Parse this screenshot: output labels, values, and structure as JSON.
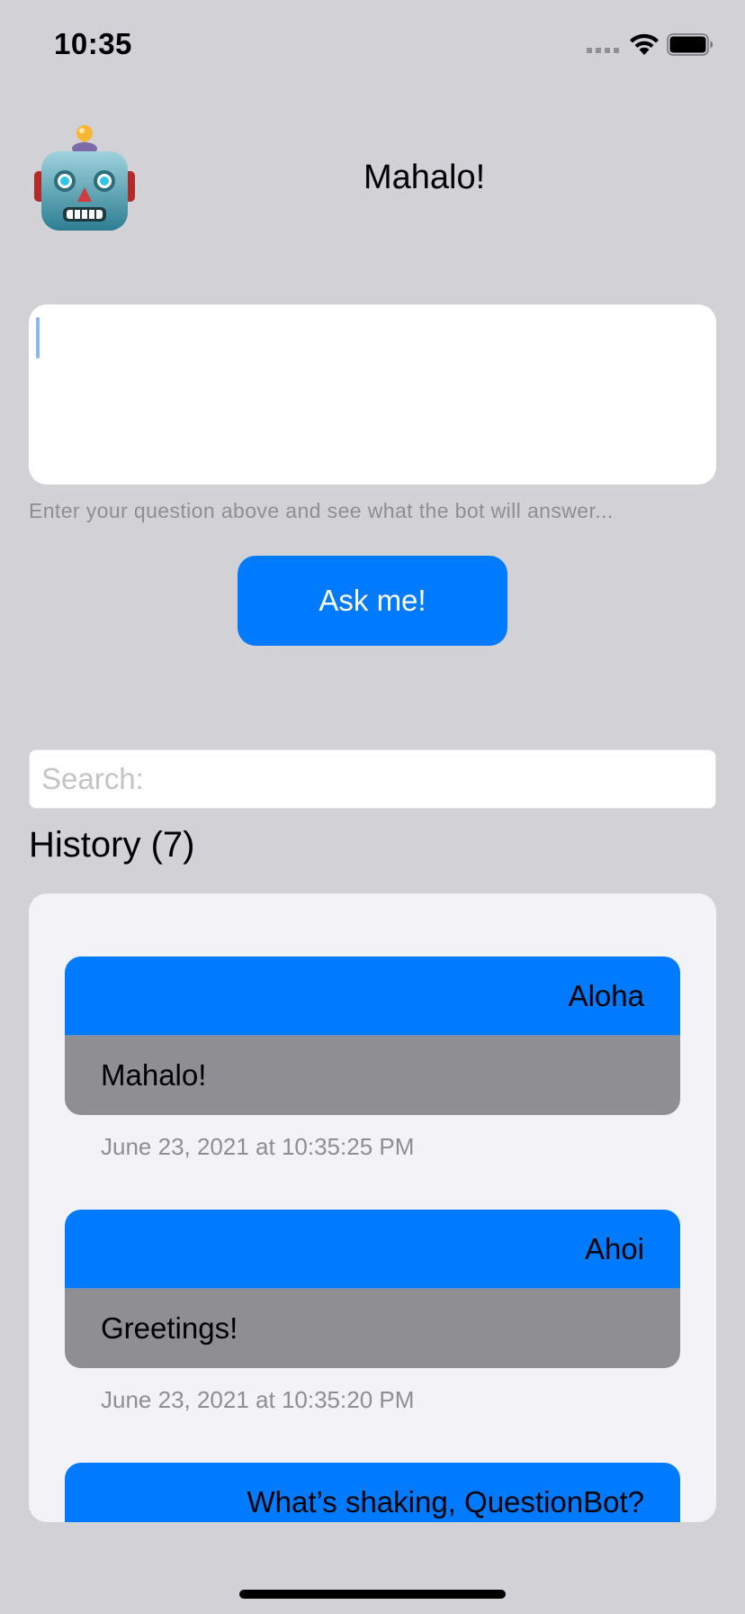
{
  "status_bar": {
    "time": "10:35"
  },
  "header": {
    "title": "Mahalo!",
    "avatar_icon": "robot-face-icon"
  },
  "question": {
    "value": "",
    "hint": "Enter your question above and see what the bot will answer..."
  },
  "ask_button": {
    "label": "Ask me!"
  },
  "search": {
    "placeholder": "Search:",
    "value": ""
  },
  "history": {
    "heading": "History (7)",
    "items": [
      {
        "question": "Aloha",
        "answer": "Mahalo!",
        "timestamp": "June 23, 2021 at 10:35:25 PM"
      },
      {
        "question": "Ahoi",
        "answer": "Greetings!",
        "timestamp": "June 23, 2021 at 10:35:20 PM"
      },
      {
        "question": "What’s shaking, QuestionBot?"
      }
    ]
  },
  "colors": {
    "background": "#d1d1d6",
    "accent": "#007aff",
    "answer_bubble": "#8e8e93",
    "panel": "#f2f2f7"
  }
}
